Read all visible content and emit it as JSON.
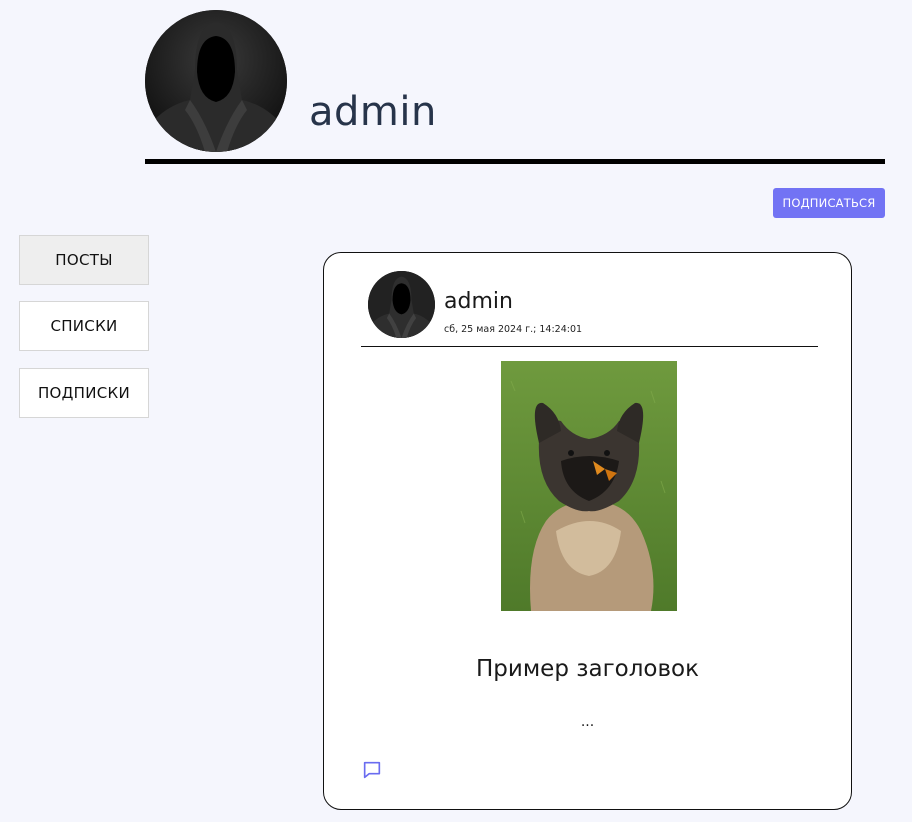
{
  "profile": {
    "username": "admin",
    "avatar_icon": "hooded-figure-avatar",
    "subscribe_label": "ПОДПИСАТЬСЯ"
  },
  "nav": {
    "tabs": [
      {
        "label": "ПОСТЫ",
        "active": true
      },
      {
        "label": "СПИСКИ",
        "active": false
      },
      {
        "label": "ПОДПИСКИ",
        "active": false
      }
    ]
  },
  "post": {
    "author": "admin",
    "date": "сб, 25 мая 2024 г.; 14:24:01",
    "image_icon": "dog-photo",
    "title": "Пример заголовок",
    "excerpt": "...",
    "comment_icon": "comment-icon"
  },
  "colors": {
    "background": "#f5f6fd",
    "accent": "#7273f4",
    "profile_name": "#27344a"
  }
}
